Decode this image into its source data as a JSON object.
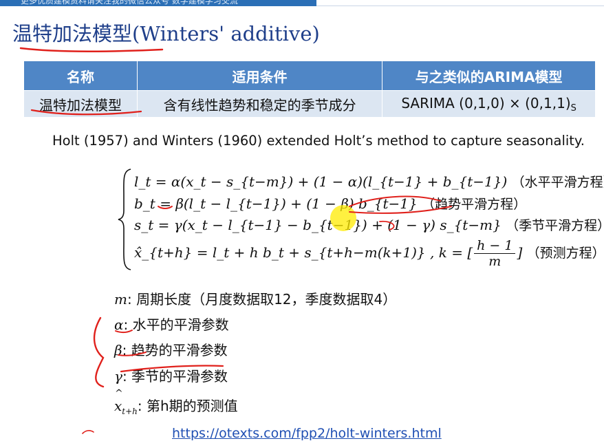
{
  "banner": {
    "text": "更多优质建模资料请关注我的微信公众号 数学建模学习交流"
  },
  "page": {
    "title": "温特加法模型(Winters' additive)"
  },
  "table": {
    "headers": [
      "名称",
      "适用条件",
      "与之类似的ARIMA模型"
    ],
    "row": {
      "name": "温特加法模型",
      "condition": "含有线性趋势和稳定的季节成分",
      "arima_main": "SARIMA (0,1,0) × (0,1,1)",
      "arima_sub": "S"
    }
  },
  "intro": "Holt (1957) and Winters (1960) extended Holt’s method to capture seasonality.",
  "equations": {
    "level": {
      "math": "l_t = α(x_t − s_{t−m}) + (1 − α)(l_{t−1} + b_{t−1})",
      "note": "（水平平滑方程）"
    },
    "trend": {
      "math": "b_t = β(l_t − l_{t−1}) + (1 − β) b_{t−1}",
      "note": "（趋势平滑方程）"
    },
    "season": {
      "math": "s_t = γ(x_t − l_{t−1} − b_{t−1}) + (1 − γ) s_{t−m}",
      "note": "（季节平滑方程）"
    },
    "forecast": {
      "math_left": "x̂_{t+h} = l_t + h b_t + s_{t+h−m(k+1)} ,  k = [",
      "frac_num": "h − 1",
      "frac_den": "m",
      "math_right": "]",
      "note": "（预测方程）"
    }
  },
  "definitions": {
    "m": {
      "sym": "m",
      "text": ": 周期长度（月度数据取12，季度数据取4）"
    },
    "alpha": {
      "sym": "α",
      "text": ": 水平的平滑参数"
    },
    "beta": {
      "sym": "β",
      "text": ": 趋势的平滑参数"
    },
    "gamma": {
      "sym": "γ",
      "text": ": 季节的平滑参数"
    },
    "xhat": {
      "sym": "x",
      "sub": "t+h",
      "text": ": 第h期的预测值"
    }
  },
  "link": {
    "text": "https://otexts.com/fpp2/holt-winters.html"
  },
  "colors": {
    "header_blue": "#4f86c6",
    "row_bg": "#dce6f2",
    "title_blue": "#1f3f8a",
    "annotation_red": "#e0201b",
    "highlight_yellow": "#ffeb00"
  }
}
